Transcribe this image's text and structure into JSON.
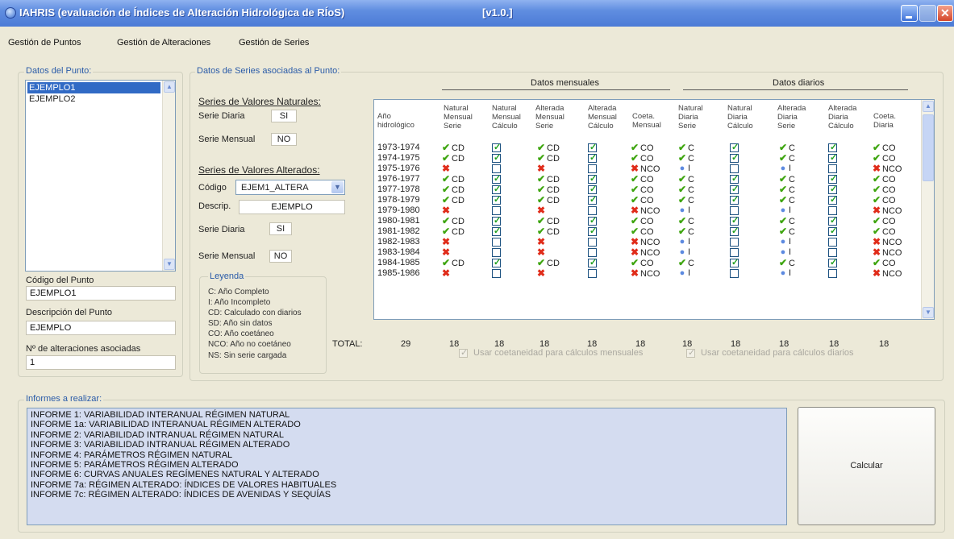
{
  "window": {
    "title": "IAHRIS (evaluación de Índices de Alteración Hidrológica de RÍoS)",
    "version": "[v1.0.]"
  },
  "menu": [
    "Gestión de Puntos",
    "Gestión de Alteraciones",
    "Gestión de Series"
  ],
  "punto_group": {
    "title": "Datos del Punto:",
    "items": [
      "EJEMPLO1",
      "EJEMPLO2"
    ],
    "selected_index": 0,
    "codigo_label": "Código del Punto",
    "codigo_value": "EJEMPLO1",
    "descripcion_label": "Descripción del Punto",
    "descripcion_value": "EJEMPLO",
    "alteraciones_label": "Nº de alteraciones asociadas",
    "alteraciones_value": "1"
  },
  "series_group": {
    "title": "Datos de Series asociadas al Punto:",
    "naturales_title": "Series de Valores Naturales:",
    "serie_diaria_label": "Serie Diaria",
    "serie_diaria_value": "SI",
    "serie_mensual_label": "Serie Mensual",
    "serie_mensual_value": "NO",
    "alterados_title": "Series de Valores Alterados:",
    "codigo_label": "Código",
    "codigo_value": "EJEM1_ALTERA",
    "descrip_label": "Descrip.",
    "descrip_value": "EJEMPLO",
    "alt_serie_diaria_label": "Serie Diaria",
    "alt_serie_diaria_value": "SI",
    "alt_serie_mensual_label": "Serie Mensual",
    "alt_serie_mensual_value": "NO"
  },
  "legend": {
    "title": "Leyenda",
    "items": [
      "C: Año Completo",
      "I: Año Incompleto",
      "CD: Calculado con diarios",
      "SD: Año sin datos",
      "CO: Año coetáneo",
      "NCO: Año no coetáneo",
      "NS: Sin serie cargada"
    ]
  },
  "grid": {
    "group_mensual": "Datos mensuales",
    "group_diario": "Datos diarios",
    "columns": [
      "Año\nhidrológico",
      "Natural\nMensual\nSerie",
      "Natural\nMensual\nCálculo",
      "Alterada\nMensual\nSerie",
      "Alterada\nMensual\nCálculo",
      "Coeta.\nMensual",
      "Natural\nDiaria\nSerie",
      "Natural\nDiaria\nCálculo",
      "Alterada\nDiaria\nSerie",
      "Alterada\nDiaria\nCálculo",
      "Coeta.\nDiaria"
    ],
    "rows": [
      {
        "year": "1973-1974",
        "ok": true,
        "nms": "CD",
        "ams": "CD",
        "cm": "CO",
        "nds": "C",
        "ads": "C",
        "cd": "CO"
      },
      {
        "year": "1974-1975",
        "ok": true,
        "nms": "CD",
        "ams": "CD",
        "cm": "CO",
        "nds": "C",
        "ads": "C",
        "cd": "CO"
      },
      {
        "year": "1975-1976",
        "ok": false,
        "nms": "",
        "ams": "",
        "cm": "NCO",
        "nds": "I",
        "ads": "I",
        "cd": "NCO"
      },
      {
        "year": "1976-1977",
        "ok": true,
        "nms": "CD",
        "ams": "CD",
        "cm": "CO",
        "nds": "C",
        "ads": "C",
        "cd": "CO"
      },
      {
        "year": "1977-1978",
        "ok": true,
        "nms": "CD",
        "ams": "CD",
        "cm": "CO",
        "nds": "C",
        "ads": "C",
        "cd": "CO"
      },
      {
        "year": "1978-1979",
        "ok": true,
        "nms": "CD",
        "ams": "CD",
        "cm": "CO",
        "nds": "C",
        "ads": "C",
        "cd": "CO"
      },
      {
        "year": "1979-1980",
        "ok": false,
        "nms": "",
        "ams": "",
        "cm": "NCO",
        "nds": "I",
        "ads": "I",
        "cd": "NCO"
      },
      {
        "year": "1980-1981",
        "ok": true,
        "nms": "CD",
        "ams": "CD",
        "cm": "CO",
        "nds": "C",
        "ads": "C",
        "cd": "CO"
      },
      {
        "year": "1981-1982",
        "ok": true,
        "nms": "CD",
        "ams": "CD",
        "cm": "CO",
        "nds": "C",
        "ads": "C",
        "cd": "CO"
      },
      {
        "year": "1982-1983",
        "ok": false,
        "nms": "",
        "ams": "",
        "cm": "NCO",
        "nds": "I",
        "ads": "I",
        "cd": "NCO"
      },
      {
        "year": "1983-1984",
        "ok": false,
        "nms": "",
        "ams": "",
        "cm": "NCO",
        "nds": "I",
        "ads": "I",
        "cd": "NCO"
      },
      {
        "year": "1984-1985",
        "ok": true,
        "nms": "CD",
        "ams": "CD",
        "cm": "CO",
        "nds": "C",
        "ads": "C",
        "cd": "CO"
      },
      {
        "year": "1985-1986",
        "ok": false,
        "nms": "",
        "ams": "",
        "cm": "NCO",
        "nds": "I",
        "ads": "I",
        "cd": "NCO"
      }
    ],
    "total_label": "TOTAL:",
    "totals": [
      "29",
      "18",
      "18",
      "18",
      "18",
      "18",
      "18",
      "18",
      "18",
      "18",
      "18"
    ]
  },
  "checkboxes": {
    "mensual": "Usar coetaneidad para cálculos mensuales",
    "diario": "Usar coetaneidad para cálculos diarios"
  },
  "informes": {
    "title": "Informes a realizar:",
    "items": [
      "INFORME 1: VARIABILIDAD INTERANUAL RÉGIMEN NATURAL",
      "INFORME 1a: VARIABILIDAD INTERANUAL RÉGIMEN ALTERADO",
      "INFORME 2: VARIABILIDAD INTRANUAL RÉGIMEN NATURAL",
      "INFORME 3: VARIABILIDAD INTRANUAL RÉGIMEN ALTERADO",
      "INFORME 4: PARÁMETROS RÉGIMEN NATURAL",
      "INFORME 5: PARÁMETROS RÉGIMEN ALTERADO",
      "INFORME 6: CURVAS ANUALES REGÍMENES NATURAL Y ALTERADO",
      "INFORME 7a: RÉGIMEN ALTERADO: ÍNDICES DE VALORES HABITUALES",
      "INFORME 7c: RÉGIMEN ALTERADO: ÍNDICES DE AVENIDAS Y SEQUÍAS"
    ],
    "button": "Calcular"
  },
  "colors": {
    "titlebar": "#4c7bd6",
    "selection": "#316ac5",
    "ok": "#3ea50f",
    "bad": "#e02c1a",
    "group_label": "#2a5ba8"
  }
}
